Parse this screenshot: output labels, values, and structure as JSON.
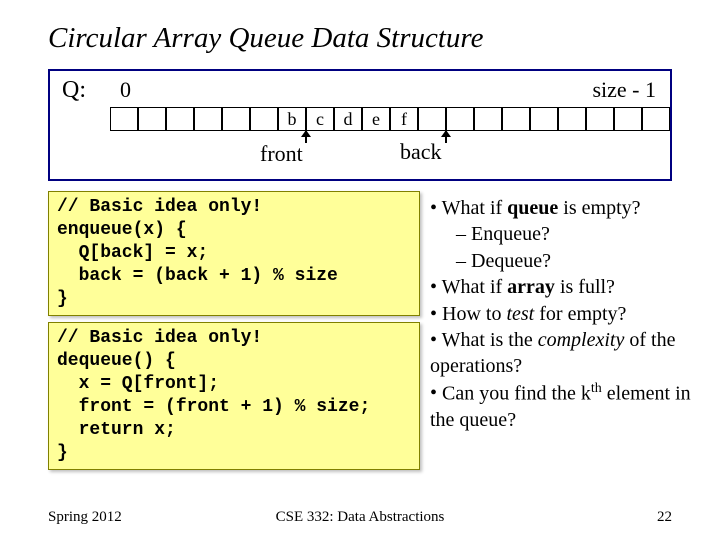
{
  "title": "Circular Array Queue Data Structure",
  "diagram": {
    "q_label": "Q:",
    "zero_label": "0",
    "size_label": "size - 1",
    "cells": [
      "",
      "",
      "",
      "",
      "",
      "",
      "b",
      "c",
      "d",
      "e",
      "f",
      "",
      "",
      "",
      "",
      "",
      "",
      "",
      "",
      ""
    ],
    "front_label": "front",
    "back_label": "back"
  },
  "code": {
    "enqueue": "// Basic idea only!\nenqueue(x) {\n  Q[back] = x;\n  back = (back + 1) % size\n}",
    "dequeue": "// Basic idea only!\ndequeue() {\n  x = Q[front];\n  front = (front + 1) % size;\n  return x;\n}"
  },
  "bullets": {
    "b1_pre": "What if ",
    "b1_bold": "queue",
    "b1_post": " is empty?",
    "b1a": "Enqueue?",
    "b1b": "Dequeue?",
    "b2_pre": "What if ",
    "b2_bold": "array",
    "b2_post": " is full?",
    "b3_pre": "How to ",
    "b3_italic": "test",
    "b3_post": " for empty?",
    "b4_pre": "What is the ",
    "b4_italic": "complexity",
    "b4_post": " of the operations?",
    "b5_pre": "Can you find the k",
    "b5_sup": "th",
    "b5_post": " element in the queue?"
  },
  "footer": {
    "left": "Spring 2012",
    "center": "CSE 332: Data Abstractions",
    "right": "22"
  }
}
